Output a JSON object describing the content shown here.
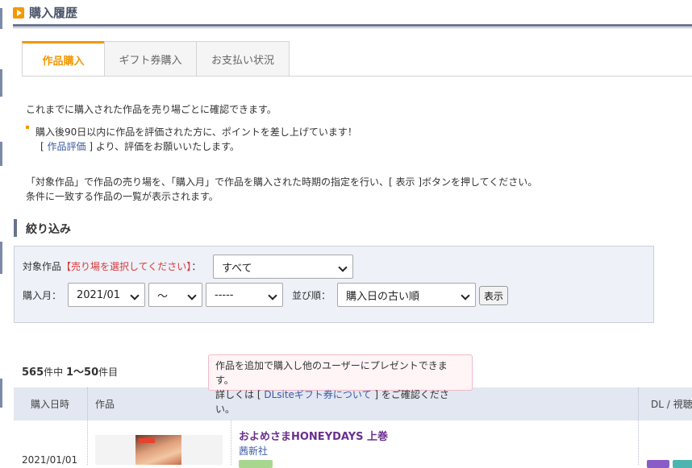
{
  "page": {
    "title": "購入履歴"
  },
  "tabs": [
    {
      "label": "作品購入",
      "active": true
    },
    {
      "label": "ギフト券購入",
      "active": false
    },
    {
      "label": "お支払い状況",
      "active": false
    }
  ],
  "intro": {
    "line1": "これまでに購入された作品を売り場ごとに確認できます。",
    "bullet": "購入後90日以内に作品を評価された方に、ポイントを差し上げています！",
    "rating_open": "[",
    "rating_link": "作品評価",
    "rating_close": "] より、評価をお願いいたします。",
    "instr1": "「対象作品」で作品の売り場を、「購入月」で作品を購入された時期の指定を行い、[ 表示 ]ボタンを押してください。",
    "instr2": "条件に一致する作品の一覧が表示されます。"
  },
  "filter": {
    "heading": "絞り込み",
    "target_label": "対象作品",
    "target_required": "【売り場を選択してください】",
    "colon": "：",
    "target_value": "すべて",
    "month_label": "購入月：",
    "month_from": "2021/01",
    "month_sep": "～",
    "month_to": "-----",
    "sort_label": "並び順：",
    "sort_value": "購入日の古い順",
    "show_button": "表示"
  },
  "results": {
    "total": "565",
    "total_unit": "件中",
    "range": "1～50",
    "range_unit": "件目"
  },
  "tooltip": {
    "line1": "作品を追加で購入し他のユーザーにプレゼントできます。",
    "line2_pre": "詳しくは [",
    "line2_link": "DLsiteギフト券について",
    "line2_post": "] をご確認ください。"
  },
  "table": {
    "headers": {
      "date": "購入日時",
      "work": "作品",
      "dl": "DL / 視聴"
    },
    "rows": [
      {
        "date": "2021/01/01",
        "title": "およめさまHONEYDAYS 上巻",
        "maker": "茜新社"
      }
    ]
  },
  "colors": {
    "accent": "#f39800",
    "heading_bar": "#68748f",
    "required": "#d83a3a",
    "link": "#3b5aa6",
    "item_title": "#6a2f8e"
  }
}
